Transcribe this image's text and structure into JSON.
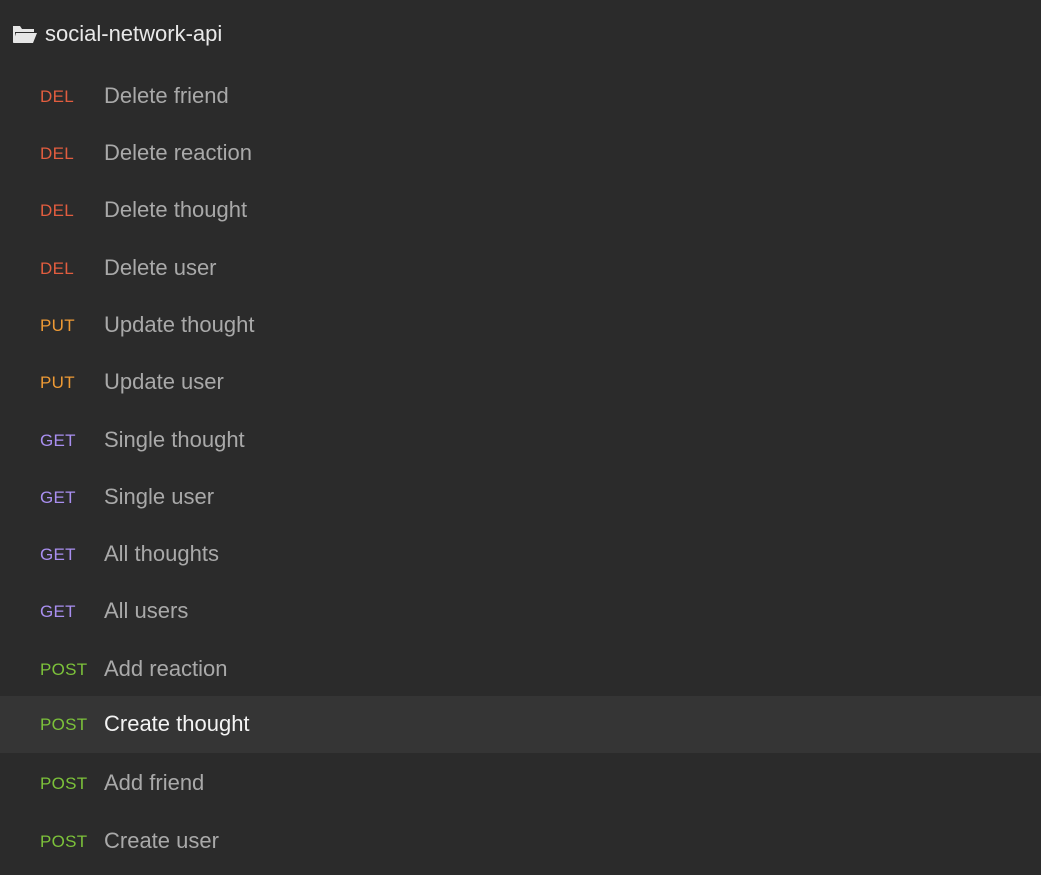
{
  "folder": {
    "name": "social-network-api",
    "icon": "folder-open-icon"
  },
  "colors": {
    "background": "#2b2b2b",
    "active_row": "#353535",
    "del": "#e25d3f",
    "put": "#ee9a35",
    "get": "#a98ff0",
    "post": "#7cc23a"
  },
  "requests": [
    {
      "method": "DEL",
      "label": "Delete friend"
    },
    {
      "method": "DEL",
      "label": "Delete reaction"
    },
    {
      "method": "DEL",
      "label": "Delete thought"
    },
    {
      "method": "DEL",
      "label": "Delete user"
    },
    {
      "method": "PUT",
      "label": "Update thought"
    },
    {
      "method": "PUT",
      "label": "Update user"
    },
    {
      "method": "GET",
      "label": "Single thought"
    },
    {
      "method": "GET",
      "label": "Single user"
    },
    {
      "method": "GET",
      "label": "All thoughts"
    },
    {
      "method": "GET",
      "label": "All users"
    },
    {
      "method": "POST",
      "label": "Add reaction"
    },
    {
      "method": "POST",
      "label": "Create thought",
      "active": true
    },
    {
      "method": "POST",
      "label": "Add friend"
    },
    {
      "method": "POST",
      "label": "Create user"
    }
  ]
}
